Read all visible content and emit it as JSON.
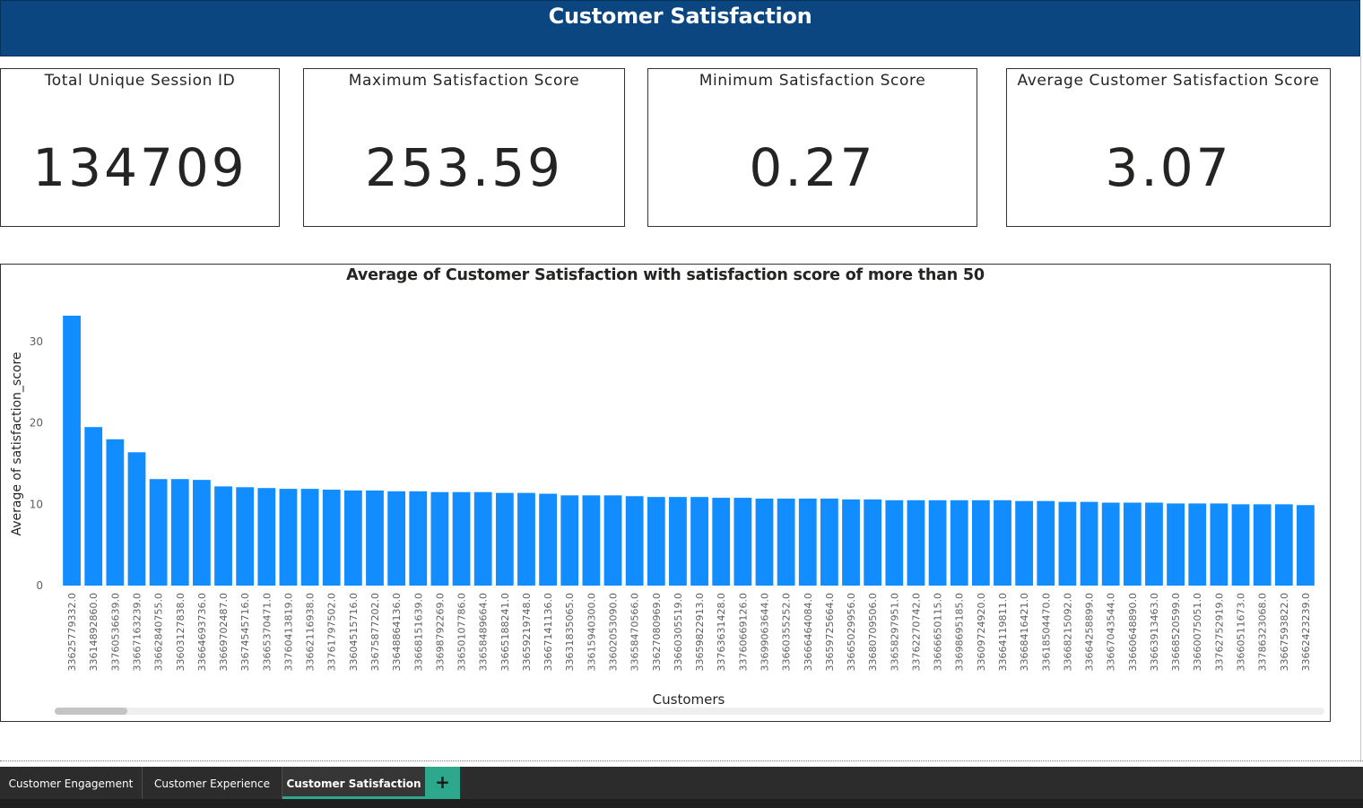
{
  "header": {
    "title": "Customer Satisfaction"
  },
  "kpis": [
    {
      "label": "Total Unique Session ID",
      "value": "134709"
    },
    {
      "label": "Maximum Satisfaction Score",
      "value": "253.59"
    },
    {
      "label": "Minimum Satisfaction Score",
      "value": "0.27"
    },
    {
      "label": "Average Customer Satisfaction Score",
      "value": "3.07"
    }
  ],
  "colors": {
    "header_bg": "#0b4680",
    "bar": "#118dff",
    "tab_accent": "#2ea88c"
  },
  "chart_data": {
    "type": "bar",
    "title": "Average of Customer Satisfaction with satisfaction score of more than 50",
    "xlabel": "Customers",
    "ylabel": "Average of satisfaction_score",
    "ylim": [
      0,
      33.2
    ],
    "yticks": [
      0,
      10,
      20,
      30
    ],
    "grid": false,
    "categories": [
      "33625779332.0",
      "33614892860.0",
      "33760536639.0",
      "33667163239.0",
      "33662840755.0",
      "33603127838.0",
      "33664693736.0",
      "33669702487.0",
      "33674545716.0",
      "33665370471.0",
      "33760413819.0",
      "33662116938.0",
      "33761797502.0",
      "33604515716.0",
      "33675877202.0",
      "33648864136.0",
      "33668151639.0",
      "33698792269.0",
      "33650107786.0",
      "33658489664.0",
      "33665188241.0",
      "33659219748.0",
      "33667141136.0",
      "33631835065.0",
      "33615940300.0",
      "33602053090.0",
      "33658470566.0",
      "33627080969.0",
      "33660305519.0",
      "33659822913.0",
      "33763631428.0",
      "33760669126.0",
      "33699063644.0",
      "33660355252.0",
      "33666464084.0",
      "33659725664.0",
      "33665029956.0",
      "33680709506.0",
      "33658297951.0",
      "33762270742.0",
      "33666650115.0",
      "33698695185.0",
      "33609724920.0",
      "33664119811.0",
      "33668416421.0",
      "33618504470.0",
      "33668215092.0",
      "33664258899.0",
      "33667043544.0",
      "33660648890.0",
      "33663913463.0",
      "33668520599.0",
      "33660075051.0",
      "33762752919.0",
      "33660511673.0",
      "33786323068.0",
      "33667593822.0",
      "33662423239.0"
    ],
    "values": [
      33.2,
      19.5,
      18.0,
      16.4,
      13.1,
      13.1,
      13.0,
      12.2,
      12.1,
      12.0,
      11.9,
      11.9,
      11.8,
      11.7,
      11.7,
      11.6,
      11.6,
      11.5,
      11.5,
      11.5,
      11.4,
      11.4,
      11.3,
      11.1,
      11.1,
      11.1,
      11.0,
      10.9,
      10.9,
      10.9,
      10.8,
      10.8,
      10.7,
      10.7,
      10.7,
      10.7,
      10.6,
      10.6,
      10.5,
      10.5,
      10.5,
      10.5,
      10.5,
      10.5,
      10.4,
      10.4,
      10.3,
      10.3,
      10.2,
      10.2,
      10.2,
      10.1,
      10.1,
      10.1,
      10.0,
      10.0,
      10.0,
      9.9
    ]
  },
  "tabs": [
    {
      "label": "Customer Engagement"
    },
    {
      "label": "Customer Experience"
    },
    {
      "label": "Customer Satisfaction"
    }
  ],
  "add_tab": "+"
}
